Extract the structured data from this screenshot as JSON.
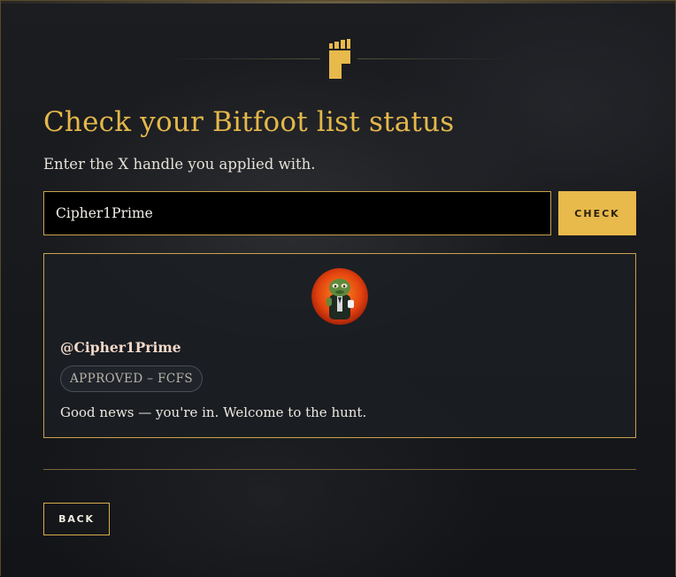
{
  "brand": {
    "logo_icon": "bitfoot-logo-icon",
    "accent_color": "#e8b94b"
  },
  "header": {
    "title": "Check your Bitfoot list status",
    "subtitle": "Enter the X handle you applied with."
  },
  "search": {
    "value": "Cipher1Prime",
    "button_label": "CHECK"
  },
  "result": {
    "avatar_icon": "avatar-image",
    "handle": "@Cipher1Prime",
    "status": "APPROVED – FCFS",
    "message": "Good news — you're in. Welcome to the hunt."
  },
  "footer": {
    "back_label": "BACK"
  }
}
